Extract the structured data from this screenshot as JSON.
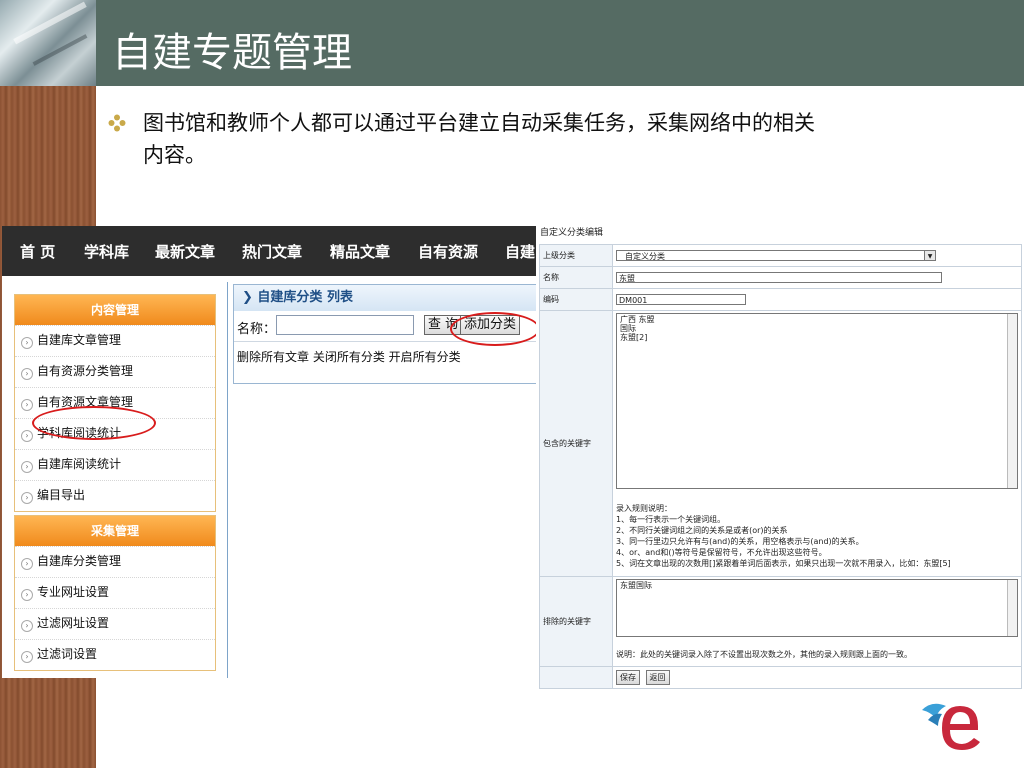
{
  "slide": {
    "title": "自建专题管理",
    "bullet_line1": "图书馆和教师个人都可以通过平台建立自动采集任务，采集网络中的相关",
    "bullet_line2": "内容。"
  },
  "left_screenshot": {
    "nav": [
      "首 页",
      "学科库",
      "最新文章",
      "热门文章",
      "精品文章",
      "自有资源",
      "自建"
    ],
    "panels": [
      {
        "title": "内容管理",
        "items": [
          "自建库文章管理",
          "自有资源分类管理",
          "自有资源文章管理",
          "学科库阅读统计",
          "自建库阅读统计",
          "编目导出"
        ]
      },
      {
        "title": "采集管理",
        "items": [
          "自建库分类管理",
          "专业网址设置",
          "过滤网址设置",
          "过滤词设置"
        ]
      }
    ],
    "content": {
      "header": "自建库分类  列表",
      "search_label": "名称：",
      "search_value": "",
      "search_button": "查 询",
      "add_button": "添加分类",
      "actions": "删除所有文章  关闭所有分类  开启所有分类"
    }
  },
  "right_screenshot": {
    "title": "自定义分类编辑",
    "labels": {
      "parent": "上级分类",
      "name": "名称",
      "code": "编码",
      "include": "包含的关键字",
      "exclude": "排除的关键字"
    },
    "parent_value": "自定义分类",
    "name_value": "东盟",
    "code_value": "DM001",
    "include_lines": [
      "广西 东盟",
      "国际",
      "东盟[2]"
    ],
    "rules": [
      "录入规则说明：",
      "1、每一行表示一个关键词组。",
      "2、不同行关键词组之间的关系是或者(or)的关系",
      "3、同一行里边只允许有与(and)的关系，用空格表示与(and)的关系。",
      "4、or、and和()等符号是保留符号，不允许出现这些符号。",
      "5、词在文章出现的次数用[]紧跟着单词后面表示，如果只出现一次就不用录入，比如：东盟[5]"
    ],
    "exclude_value": "东盟国际",
    "exclude_note": "说明：此处的关键词录入除了不设置出现次数之外，其他的录入规则跟上面的一致。",
    "save_button": "保存",
    "back_button": "返回"
  }
}
